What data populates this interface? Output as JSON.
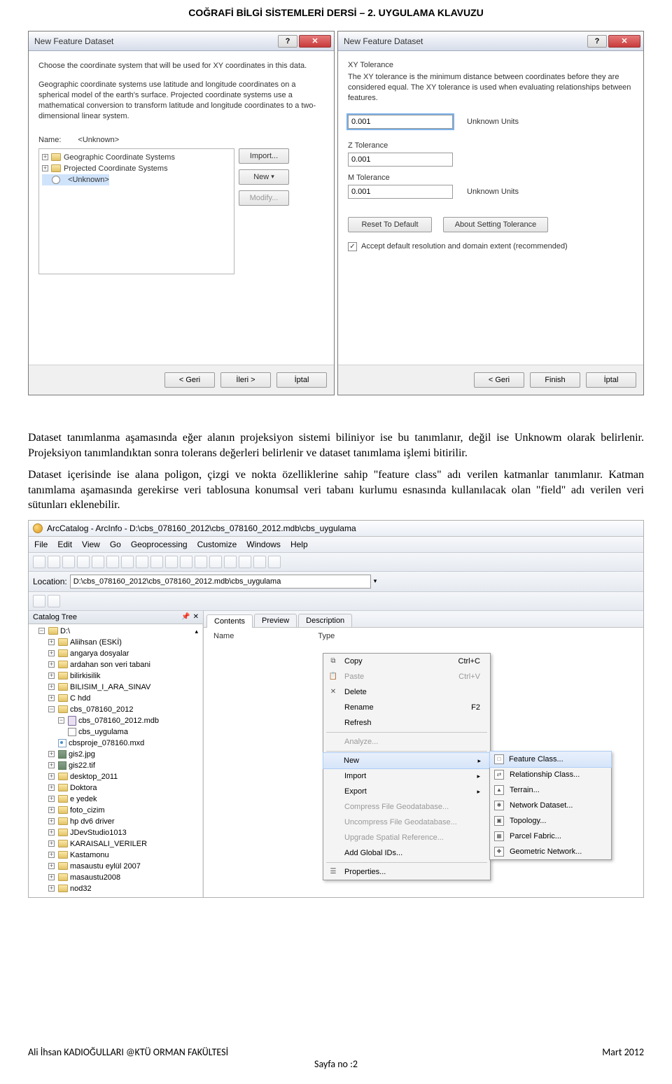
{
  "doc_header": "COĞRAFİ BİLGİ SİSTEMLERİ DERSİ – 2. UYGULAMA KLAVUZU",
  "dlg1": {
    "title": "New Feature Dataset",
    "intro": "Choose the coordinate system that will be used for XY coordinates in this data.",
    "desc": "Geographic coordinate systems use latitude and longitude coordinates on a spherical model of the earth's surface. Projected coordinate systems use a mathematical conversion to transform latitude and longitude coordinates to a two-dimensional linear system.",
    "name_label": "Name:",
    "name_value": "<Unknown>",
    "tree": {
      "gcs": "Geographic Coordinate Systems",
      "pcs": "Projected Coordinate Systems",
      "unk": "<Unknown>"
    },
    "btn_import": "Import...",
    "btn_new": "New",
    "btn_modify": "Modify...",
    "btn_back": "< Geri",
    "btn_next": "İleri >",
    "btn_cancel": "İptal"
  },
  "dlg2": {
    "title": "New Feature Dataset",
    "xy_label": "XY Tolerance",
    "xy_desc": "The XY tolerance is the minimum distance between coordinates before they are considered equal. The XY tolerance is used when evaluating relationships between features.",
    "xy_value": "0.001",
    "xy_units": "Unknown Units",
    "z_label": "Z Tolerance",
    "z_value": "0.001",
    "m_label": "M Tolerance",
    "m_value": "0.001",
    "m_units": "Unknown Units",
    "btn_reset": "Reset To Default",
    "btn_about": "About Setting Tolerance",
    "chk_label": "Accept default resolution and domain extent (recommended)",
    "btn_back": "< Geri",
    "btn_finish": "Finish",
    "btn_cancel": "İptal"
  },
  "para1": "Dataset tanımlanma aşamasında eğer alanın projeksiyon sistemi biliniyor ise bu tanımlanır, değil ise Unknowm olarak belirlenir. Projeksiyon tanımlandıktan sonra tolerans değerleri belirlenir ve dataset tanımlama işlemi bitirilir.",
  "para2": "Dataset içerisinde ise alana poligon, çizgi ve nokta özelliklerine sahip \"feature class\" adı verilen katmanlar tanımlanır. Katman tanımlama aşamasında gerekirse veri tablosuna konumsal veri tabanı kurlumu esnasında kullanılacak olan \"field\" adı verilen veri sütunları eklenebilir.",
  "arccat": {
    "title": "ArcCatalog - ArcInfo - D:\\cbs_078160_2012\\cbs_078160_2012.mdb\\cbs_uygulama",
    "menus": [
      "File",
      "Edit",
      "View",
      "Go",
      "Geoprocessing",
      "Customize",
      "Windows",
      "Help"
    ],
    "loc_label": "Location:",
    "loc_value": "D:\\cbs_078160_2012\\cbs_078160_2012.mdb\\cbs_uygulama",
    "tree_header": "Catalog Tree",
    "tree": {
      "root": "D:\\",
      "items": [
        "Aliihsan (ESKİ)",
        "angarya dosyalar",
        "ardahan son veri tabani",
        "bilirkisilik",
        "BILISIM_I_ARA_SINAV",
        "C hdd",
        "cbs_078160_2012"
      ],
      "sub_mdb": "cbs_078160_2012.mdb",
      "sub_ds": "cbs_uygulama",
      "sub_mxd": "cbsproje_078160.mxd",
      "sub_tif1": "gis2.jpg",
      "sub_tif2": "gis22.tif",
      "items2": [
        "desktop_2011",
        "Doktora",
        "e yedek",
        "foto_cizim",
        "hp dv6 driver",
        "JDevStudio1013",
        "KARAISALI_VERILER",
        "Kastamonu",
        "masaustu eylül 2007",
        "masaustu2008",
        "nod32"
      ]
    },
    "tabs": {
      "contents": "Contents",
      "preview": "Preview",
      "description": "Description"
    },
    "cols": {
      "name": "Name",
      "type": "Type"
    },
    "ctx": {
      "copy": "Copy",
      "copy_sc": "Ctrl+C",
      "paste": "Paste",
      "paste_sc": "Ctrl+V",
      "delete": "Delete",
      "rename": "Rename",
      "rename_sc": "F2",
      "refresh": "Refresh",
      "analyze": "Analyze...",
      "new": "New",
      "import": "Import",
      "export": "Export",
      "compress": "Compress File Geodatabase...",
      "uncompress": "Uncompress File Geodatabase...",
      "upgrade": "Upgrade Spatial Reference...",
      "addglobal": "Add Global IDs...",
      "properties": "Properties..."
    },
    "submenu": {
      "fc": "Feature Class...",
      "rc": "Relationship Class...",
      "terrain": "Terrain...",
      "nd": "Network Dataset...",
      "topo": "Topology...",
      "pf": "Parcel Fabric...",
      "gn": "Geometric Network..."
    }
  },
  "footer": {
    "left": "Ali İhsan KADIOĞULLARI @KTÜ ORMAN FAKÜLTESİ",
    "right": "Mart 2012",
    "center": "Sayfa no :2"
  }
}
